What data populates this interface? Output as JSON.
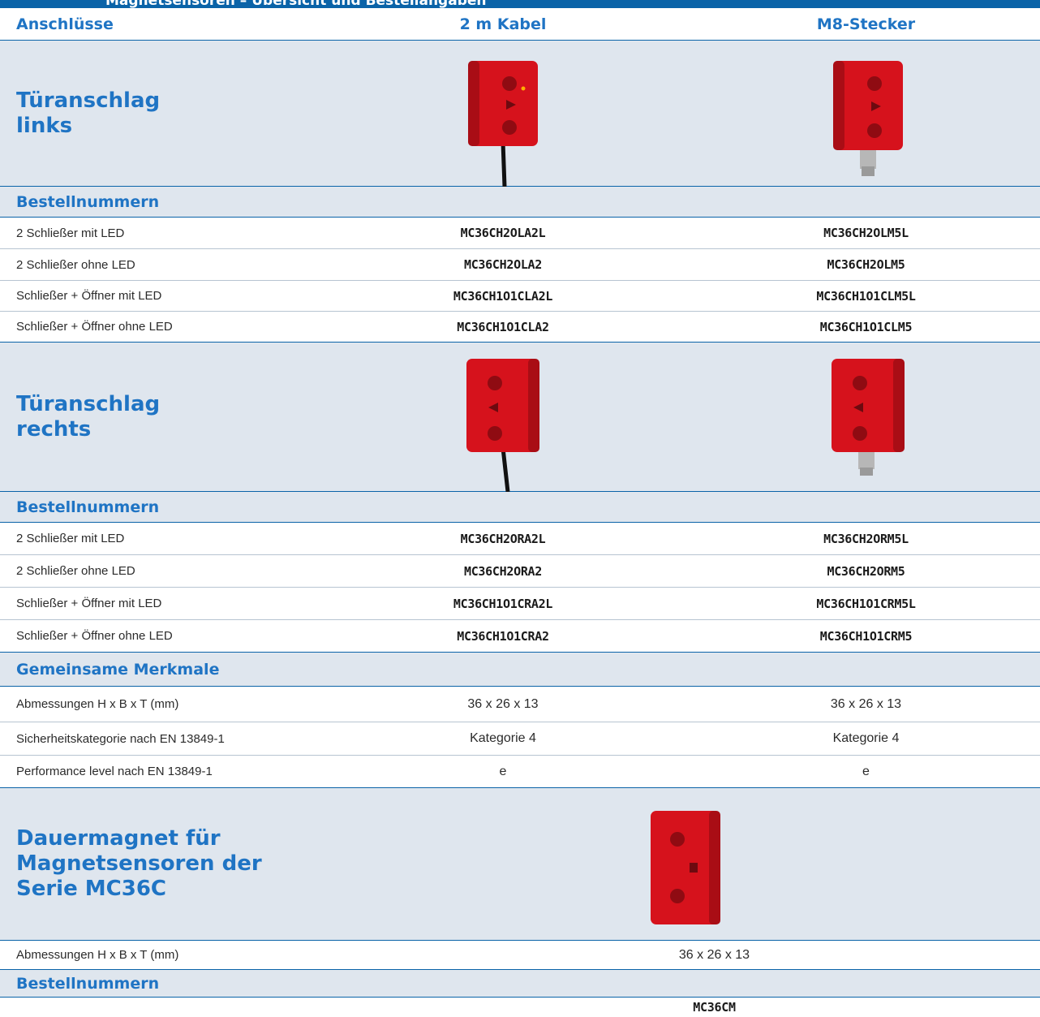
{
  "header_title": "Magnetsensoren – Übersicht und Bestellangaben",
  "columns": {
    "label": "Anschlüsse",
    "col1": "2 m Kabel",
    "col2": "M8-Stecker"
  },
  "left_hinge": {
    "title": "Türanschlag\nlinks",
    "order_heading": "Bestellnummern",
    "rows": [
      {
        "label": "2 Schließer mit LED",
        "col1": "MC36CH2OLA2L",
        "col2": "MC36CH2OLM5L"
      },
      {
        "label": "2 Schließer ohne LED",
        "col1": "MC36CH2OLA2",
        "col2": "MC36CH2OLM5"
      },
      {
        "label": "Schließer + Öffner mit LED",
        "col1": "MC36CH1O1CLA2L",
        "col2": "MC36CH1O1CLM5L"
      },
      {
        "label": "Schließer + Öffner ohne LED",
        "col1": "MC36CH1O1CLA2",
        "col2": "MC36CH1O1CLM5"
      }
    ]
  },
  "right_hinge": {
    "title": "Türanschlag\nrechts",
    "order_heading": "Bestellnummern",
    "rows": [
      {
        "label": "2 Schließer mit LED",
        "col1": "MC36CH2ORA2L",
        "col2": "MC36CH2ORM5L"
      },
      {
        "label": "2 Schließer ohne LED",
        "col1": "MC36CH2ORA2",
        "col2": "MC36CH2ORM5"
      },
      {
        "label": "Schließer + Öffner mit LED",
        "col1": "MC36CH1O1CRA2L",
        "col2": "MC36CH1O1CRM5L"
      },
      {
        "label": "Schließer + Öffner ohne LED",
        "col1": "MC36CH1O1CRA2",
        "col2": "MC36CH1O1CRM5"
      }
    ]
  },
  "common": {
    "heading": "Gemeinsame Merkmale",
    "rows": [
      {
        "label": "Abmessungen H x B x T (mm)",
        "col1": "36 x 26 x 13",
        "col2": "36 x 26 x 13"
      },
      {
        "label": "Sicherheitskategorie nach EN 13849-1",
        "col1": "Kategorie 4",
        "col2": "Kategorie 4"
      },
      {
        "label": "Performance level nach EN 13849-1",
        "col1": "e",
        "col2": "e"
      }
    ]
  },
  "magnet": {
    "title": "Dauermagnet für\nMagnetsensoren der\nSerie MC36C",
    "dimensions_label": "Abmessungen H x B x T (mm)",
    "dimensions_value": "36 x 26 x 13",
    "order_heading": "Bestellnummern",
    "order_code": "MC36CM"
  },
  "colors": {
    "accent_blue": "#1f74c4",
    "header_blue": "#0a63a8",
    "panel_grey": "#dfe6ee",
    "product_red": "#d6121c"
  }
}
